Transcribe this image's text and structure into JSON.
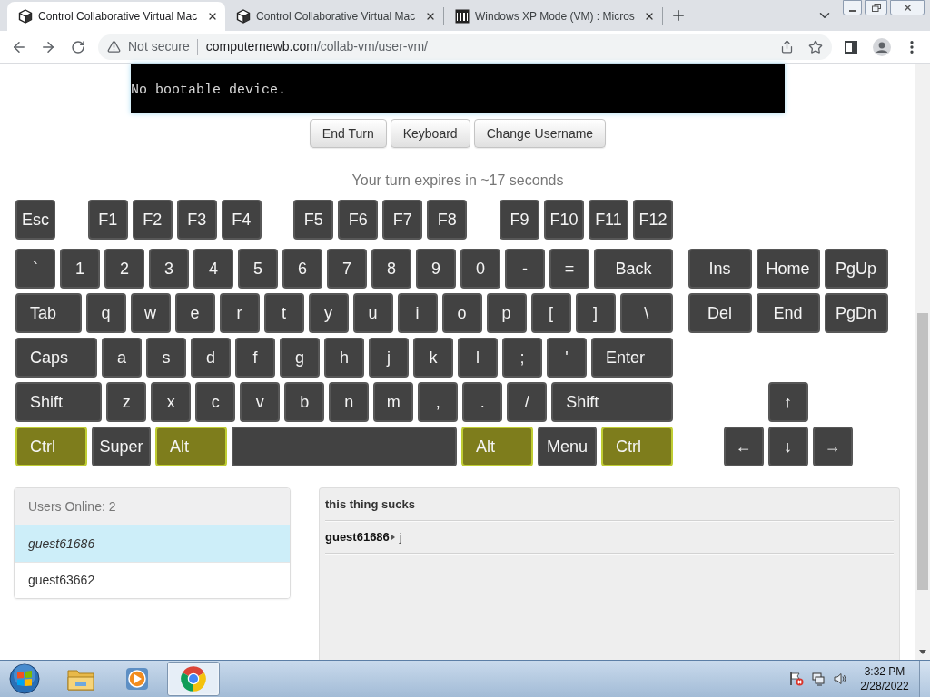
{
  "browser": {
    "tabs": [
      {
        "kind": "cube",
        "title": "Control Collaborative Virtual Mac",
        "selected": true
      },
      {
        "kind": "cube",
        "title": "Control Collaborative Virtual Mac",
        "selected": false
      },
      {
        "kind": "archive",
        "title": "Windows XP Mode (VM) : Micros",
        "selected": false
      }
    ],
    "address_bar": {
      "security": "Not secure",
      "host": "computernewb.com",
      "path": "/collab-vm/user-vm/"
    }
  },
  "vm_screen": {
    "lines": [
      "No bootable device."
    ]
  },
  "vm_buttons": [
    "End Turn",
    "Keyboard",
    "Change Username"
  ],
  "turn_status": "Your turn expires in ~17 seconds",
  "keyboard": {
    "rows": [
      {
        "groups": [
          [
            {
              "label": "Esc",
              "kind": "char",
              "pressed": false
            }
          ],
          [
            {
              "label": "F1",
              "kind": "char",
              "pressed": false
            },
            {
              "label": "F2",
              "kind": "char",
              "pressed": false
            },
            {
              "label": "F3",
              "kind": "char",
              "pressed": false
            },
            {
              "label": "F4",
              "kind": "char",
              "pressed": false
            }
          ],
          [
            {
              "label": "F5",
              "kind": "char",
              "pressed": false
            },
            {
              "label": "F6",
              "kind": "char",
              "pressed": false
            },
            {
              "label": "F7",
              "kind": "char",
              "pressed": false
            },
            {
              "label": "F8",
              "kind": "char",
              "pressed": false
            }
          ],
          [
            {
              "label": "F9",
              "kind": "char",
              "pressed": false
            },
            {
              "label": "F10",
              "kind": "char",
              "pressed": false
            },
            {
              "label": "F11",
              "kind": "char",
              "pressed": false
            },
            {
              "label": "F12",
              "kind": "char",
              "pressed": false
            }
          ]
        ]
      },
      {
        "groups": [
          [
            {
              "label": "`",
              "kind": "char",
              "pressed": false
            },
            {
              "label": "1",
              "kind": "char",
              "pressed": false
            },
            {
              "label": "2",
              "kind": "char",
              "pressed": false
            },
            {
              "label": "3",
              "kind": "char",
              "pressed": false
            },
            {
              "label": "4",
              "kind": "char",
              "pressed": false
            },
            {
              "label": "5",
              "kind": "char",
              "pressed": false
            },
            {
              "label": "6",
              "kind": "char",
              "pressed": false
            },
            {
              "label": "7",
              "kind": "char",
              "pressed": false
            },
            {
              "label": "8",
              "kind": "char",
              "pressed": false
            },
            {
              "label": "9",
              "kind": "char",
              "pressed": false
            },
            {
              "label": "0",
              "kind": "char",
              "pressed": false
            },
            {
              "label": "-",
              "kind": "char",
              "pressed": false
            },
            {
              "label": "=",
              "kind": "char",
              "pressed": false
            },
            {
              "label": "Back",
              "kind": "wide",
              "pressed": false
            }
          ]
        ],
        "side": [
          {
            "label": "Ins",
            "kind": "nav",
            "pressed": false
          },
          {
            "label": "Home",
            "kind": "nav",
            "pressed": false
          },
          {
            "label": "PgUp",
            "kind": "nav",
            "pressed": false
          }
        ]
      },
      {
        "groups": [
          [
            {
              "label": "Tab",
              "kind": "mod",
              "pressed": false
            },
            {
              "label": "q",
              "kind": "char",
              "pressed": false
            },
            {
              "label": "w",
              "kind": "char",
              "pressed": false
            },
            {
              "label": "e",
              "kind": "char",
              "pressed": false
            },
            {
              "label": "r",
              "kind": "char",
              "pressed": false
            },
            {
              "label": "t",
              "kind": "char",
              "pressed": false
            },
            {
              "label": "y",
              "kind": "char",
              "pressed": false
            },
            {
              "label": "u",
              "kind": "char",
              "pressed": false
            },
            {
              "label": "i",
              "kind": "char",
              "pressed": false
            },
            {
              "label": "o",
              "kind": "char",
              "pressed": false
            },
            {
              "label": "p",
              "kind": "char",
              "pressed": false
            },
            {
              "label": "[",
              "kind": "char",
              "pressed": false
            },
            {
              "label": "]",
              "kind": "char",
              "pressed": false
            },
            {
              "label": "\\",
              "kind": "wide",
              "pressed": false
            }
          ]
        ],
        "side": [
          {
            "label": "Del",
            "kind": "nav",
            "pressed": false
          },
          {
            "label": "End",
            "kind": "nav",
            "pressed": false
          },
          {
            "label": "PgDn",
            "kind": "nav",
            "pressed": false
          }
        ]
      },
      {
        "groups": [
          [
            {
              "label": "Caps",
              "kind": "mod",
              "pressed": false
            },
            {
              "label": "a",
              "kind": "char",
              "pressed": false
            },
            {
              "label": "s",
              "kind": "char",
              "pressed": false
            },
            {
              "label": "d",
              "kind": "char",
              "pressed": false
            },
            {
              "label": "f",
              "kind": "char",
              "pressed": false
            },
            {
              "label": "g",
              "kind": "char",
              "pressed": false
            },
            {
              "label": "h",
              "kind": "char",
              "pressed": false
            },
            {
              "label": "j",
              "kind": "char",
              "pressed": false
            },
            {
              "label": "k",
              "kind": "char",
              "pressed": false
            },
            {
              "label": "l",
              "kind": "char",
              "pressed": false
            },
            {
              "label": ";",
              "kind": "char",
              "pressed": false
            },
            {
              "label": "'",
              "kind": "char",
              "pressed": false
            },
            {
              "label": "Enter",
              "kind": "mod",
              "pressed": false
            }
          ]
        ]
      },
      {
        "groups": [
          [
            {
              "label": "Shift",
              "kind": "mod",
              "pressed": false
            },
            {
              "label": "z",
              "kind": "char",
              "pressed": false
            },
            {
              "label": "x",
              "kind": "char",
              "pressed": false
            },
            {
              "label": "c",
              "kind": "char",
              "pressed": false
            },
            {
              "label": "v",
              "kind": "char",
              "pressed": false
            },
            {
              "label": "b",
              "kind": "char",
              "pressed": false
            },
            {
              "label": "n",
              "kind": "char",
              "pressed": false
            },
            {
              "label": "m",
              "kind": "char",
              "pressed": false
            },
            {
              "label": ",",
              "kind": "char",
              "pressed": false
            },
            {
              "label": ".",
              "kind": "char",
              "pressed": false
            },
            {
              "label": "/",
              "kind": "char",
              "pressed": false
            },
            {
              "label": "Shift",
              "kind": "mod_wide",
              "pressed": false
            }
          ]
        ],
        "side": [
          {
            "label": "↑",
            "kind": "char",
            "pressed": false
          }
        ]
      },
      {
        "groups": [
          [
            {
              "label": "Ctrl",
              "kind": "mod",
              "pressed": true
            },
            {
              "label": "Super",
              "kind": "wide",
              "pressed": false
            },
            {
              "label": "Alt",
              "kind": "mod",
              "pressed": true
            },
            {
              "kind": "space",
              "pressed": false
            },
            {
              "label": "Alt",
              "kind": "mod",
              "pressed": true
            },
            {
              "label": "Menu",
              "kind": "wide",
              "pressed": false
            },
            {
              "label": "Ctrl",
              "kind": "mod",
              "pressed": true
            }
          ]
        ],
        "side": [
          {
            "label": "←",
            "kind": "char",
            "pressed": false
          },
          {
            "label": "↓",
            "kind": "char",
            "pressed": false
          },
          {
            "label": "→",
            "kind": "char",
            "pressed": false
          }
        ]
      }
    ]
  },
  "users": {
    "header": "Users Online: 2",
    "list": [
      {
        "name": "guest61686",
        "selected": true
      },
      {
        "name": "guest63662",
        "selected": false
      }
    ]
  },
  "chat": {
    "messages": [
      {
        "kind": "notice",
        "text": "this thing sucks"
      },
      {
        "kind": "message",
        "user": "guest61686",
        "text": "j"
      }
    ]
  },
  "taskbar": {
    "apps": [
      {
        "kind": "folder",
        "active": false
      },
      {
        "kind": "media",
        "active": false
      },
      {
        "kind": "browser",
        "active": true
      }
    ],
    "clock": {
      "time": "3:32 PM",
      "date": "2/28/2022"
    }
  }
}
